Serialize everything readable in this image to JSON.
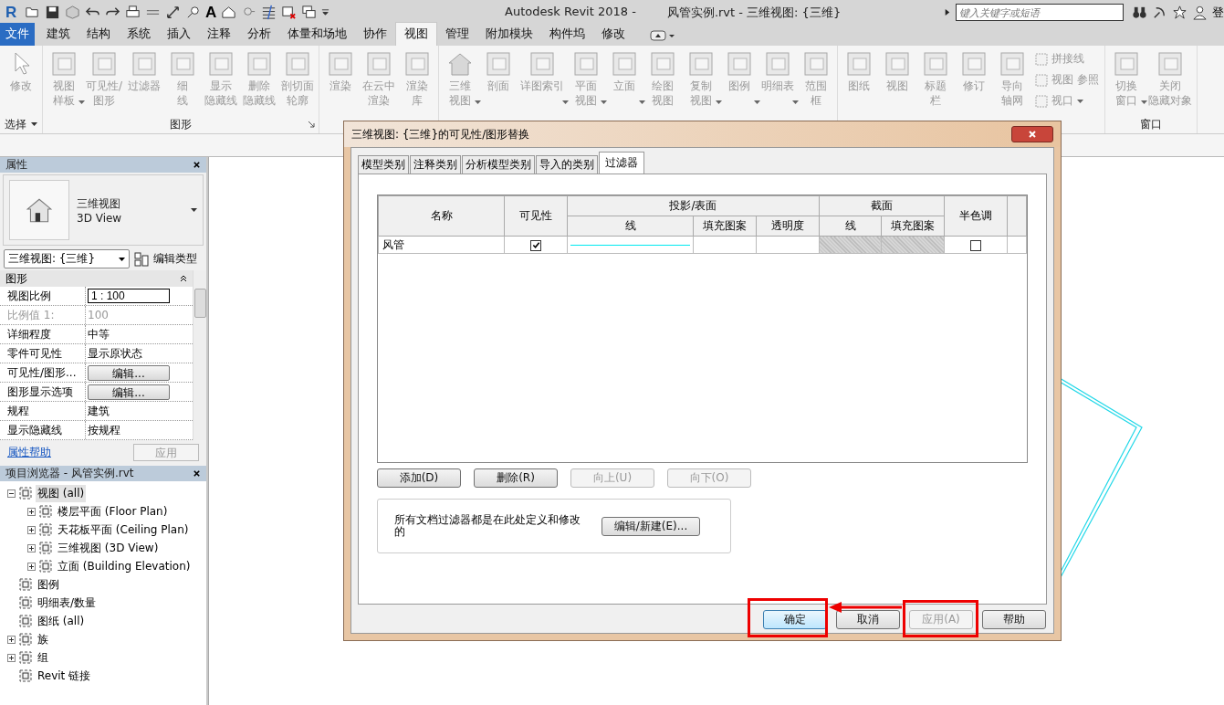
{
  "title_bar": {
    "app_logo": "R",
    "text_tool": "A",
    "title": "Autodesk Revit 2018 -",
    "document": "风管实例.rvt - 三维视图: {三维}",
    "search": {
      "placeholder": "键入关键字或短语"
    },
    "sign_in": "登"
  },
  "ribbon_tabs": [
    {
      "label": "文件",
      "kind": "file",
      "selected": false
    },
    {
      "label": "建筑",
      "kind": "tab",
      "selected": false
    },
    {
      "label": "结构",
      "kind": "tab",
      "selected": false
    },
    {
      "label": "系统",
      "kind": "tab",
      "selected": false
    },
    {
      "label": "插入",
      "kind": "tab",
      "selected": false
    },
    {
      "label": "注释",
      "kind": "tab",
      "selected": false
    },
    {
      "label": "分析",
      "kind": "tab",
      "selected": false
    },
    {
      "label": "体量和场地",
      "kind": "tab",
      "selected": false
    },
    {
      "label": "协作",
      "kind": "tab",
      "selected": false
    },
    {
      "label": "视图",
      "kind": "tab",
      "selected": true
    },
    {
      "label": "管理",
      "kind": "tab",
      "selected": false
    },
    {
      "label": "附加模块",
      "kind": "tab",
      "selected": false
    },
    {
      "label": "构件坞",
      "kind": "tab",
      "selected": false
    },
    {
      "label": "修改",
      "kind": "tab",
      "selected": false
    }
  ],
  "ribbon_groups": [
    {
      "label": "选择",
      "buttons": [
        {
          "lines": [
            "修改"
          ],
          "dropdown": false
        }
      ]
    },
    {
      "label": "图形",
      "buttons": [
        {
          "lines": [
            "视图",
            "样板"
          ],
          "dropdown": true
        },
        {
          "lines": [
            "可见性/",
            "图形"
          ],
          "dropdown": false
        },
        {
          "lines": [
            "过滤器"
          ],
          "dropdown": false
        },
        {
          "lines": [
            "细",
            "线"
          ],
          "dropdown": false
        },
        {
          "lines": [
            "显示",
            "隐藏线"
          ],
          "dropdown": false
        },
        {
          "lines": [
            "删除",
            "隐藏线"
          ],
          "dropdown": false
        },
        {
          "lines": [
            "剖切面",
            "轮廓"
          ],
          "dropdown": false
        }
      ]
    },
    {
      "buttons": [
        {
          "lines": [
            "渲染"
          ],
          "dropdown": false
        },
        {
          "lines": [
            "在云中",
            "渲染"
          ],
          "dropdown": false
        },
        {
          "lines": [
            "渲染",
            "库"
          ],
          "dropdown": false
        }
      ]
    },
    {
      "buttons": [
        {
          "lines": [
            "三维",
            "视图"
          ],
          "dropdown": true
        },
        {
          "lines": [
            "剖面"
          ],
          "dropdown": false
        },
        {
          "lines": [
            "详图索引"
          ],
          "dropdown": true
        },
        {
          "lines": [
            "平面",
            "视图"
          ],
          "dropdown": true
        },
        {
          "lines": [
            "立面"
          ],
          "dropdown": true
        },
        {
          "lines": [
            "绘图",
            "视图"
          ],
          "dropdown": false
        },
        {
          "lines": [
            "复制",
            "视图"
          ],
          "dropdown": true
        },
        {
          "lines": [
            "图例"
          ],
          "dropdown": true
        },
        {
          "lines": [
            "明细表"
          ],
          "dropdown": true
        },
        {
          "lines": [
            "范围",
            "框"
          ],
          "dropdown": false
        }
      ]
    },
    {
      "buttons": [
        {
          "lines": [
            "图纸"
          ],
          "dropdown": false
        },
        {
          "lines": [
            "视图"
          ],
          "dropdown": false
        },
        {
          "lines": [
            "标题",
            "栏"
          ],
          "dropdown": false
        },
        {
          "lines": [
            "修订"
          ],
          "dropdown": false
        },
        {
          "lines": [
            "导向",
            "轴网"
          ],
          "dropdown": false
        }
      ],
      "small_buttons": [
        {
          "label": "拼接线",
          "dropdown": false
        },
        {
          "label": "视图 参照",
          "dropdown": false
        },
        {
          "label": "视口",
          "dropdown": true
        }
      ]
    },
    {
      "label": "窗口",
      "buttons": [
        {
          "lines": [
            "切换",
            "窗口"
          ],
          "dropdown": true
        },
        {
          "lines": [
            "关闭",
            "隐藏对象"
          ],
          "dropdown": false
        }
      ]
    }
  ],
  "properties": {
    "title": "属性",
    "type_name": "三维视图",
    "type_name_en": "3D View",
    "instance": "三维视图: {三维}",
    "edit_type": "编辑类型",
    "category": "图形",
    "rows": [
      {
        "label": "视图比例",
        "value": "1 : 100",
        "kind": "input",
        "disabled": false
      },
      {
        "label": "比例值 1:",
        "value": "100",
        "kind": "text",
        "disabled": true
      },
      {
        "label": "详细程度",
        "value": "中等",
        "kind": "text",
        "disabled": false
      },
      {
        "label": "零件可见性",
        "value": "显示原状态",
        "kind": "text",
        "disabled": false
      },
      {
        "label": "可见性/图形...",
        "value": "编辑...",
        "kind": "button",
        "disabled": false
      },
      {
        "label": "图形显示选项",
        "value": "编辑...",
        "kind": "button",
        "disabled": false
      },
      {
        "label": "规程",
        "value": "建筑",
        "kind": "text",
        "disabled": false
      },
      {
        "label": "显示隐藏线",
        "value": "按规程",
        "kind": "text",
        "disabled": false
      }
    ],
    "help_link": "属性帮助",
    "apply": "应用"
  },
  "project_browser": {
    "title": "项目浏览器 - 风管实例.rvt",
    "items": [
      {
        "label": "视图 (all)",
        "expanded": true,
        "selected": true,
        "children": [
          {
            "label": "楼层平面 (Floor Plan)",
            "expanded": false,
            "selected": false
          },
          {
            "label": "天花板平面 (Ceiling Plan)",
            "expanded": false,
            "selected": false
          },
          {
            "label": "三维视图 (3D View)",
            "expanded": false,
            "selected": false
          },
          {
            "label": "立面 (Building Elevation)",
            "expanded": false,
            "selected": false
          }
        ]
      },
      {
        "label": "图例",
        "selected": false
      },
      {
        "label": "明细表/数量",
        "selected": false
      },
      {
        "label": "图纸 (all)",
        "selected": false
      },
      {
        "label": "族",
        "expanded": false,
        "selected": false
      },
      {
        "label": "组",
        "expanded": false,
        "selected": false
      },
      {
        "label": "Revit 链接",
        "selected": false
      }
    ]
  },
  "dialog": {
    "title": "三维视图: {三维}的可见性/图形替换",
    "tabs": [
      {
        "label": "模型类别",
        "selected": false
      },
      {
        "label": "注释类别",
        "selected": false
      },
      {
        "label": "分析模型类别",
        "selected": false
      },
      {
        "label": "导入的类别",
        "selected": false
      },
      {
        "label": "过滤器",
        "selected": true
      }
    ],
    "columns": [
      {
        "label": "名称"
      },
      {
        "label": "可见性"
      },
      {
        "label": "投影/表面",
        "children": [
          "线",
          "填充图案",
          "透明度"
        ]
      },
      {
        "label": "截面",
        "children": [
          "线",
          "填充图案"
        ]
      },
      {
        "label": "半色调"
      }
    ],
    "rows": [
      {
        "name": "风管",
        "visible": true,
        "halftone": false
      }
    ],
    "row_buttons": [
      {
        "label": "添加(D)",
        "disabled": false
      },
      {
        "label": "删除(R)",
        "disabled": false
      },
      {
        "label": "向上(U)",
        "disabled": true
      },
      {
        "label": "向下(O)",
        "disabled": true
      }
    ],
    "info": "所有文档过滤器都是在此处定义和修改的",
    "edit_new": "编辑/新建(E)...",
    "footer_buttons": [
      {
        "label": "确定",
        "disabled": false,
        "default": true
      },
      {
        "label": "取消",
        "disabled": false,
        "default": false
      },
      {
        "label": "应用(A)",
        "disabled": true,
        "default": false
      },
      {
        "label": "帮助",
        "disabled": false,
        "default": false
      }
    ]
  }
}
